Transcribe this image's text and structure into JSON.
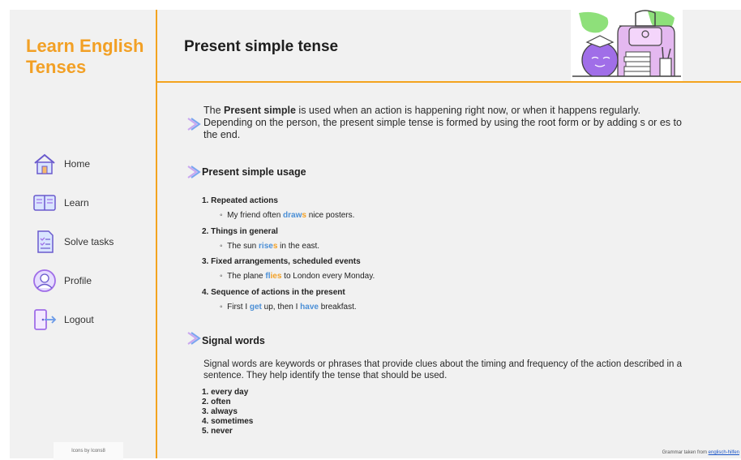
{
  "sidebar": {
    "brand_line1": "Learn English",
    "brand_line2": "Tenses",
    "items": [
      {
        "label": "Home",
        "icon": "home-icon"
      },
      {
        "label": "Learn",
        "icon": "book-icon"
      },
      {
        "label": "Solve tasks",
        "icon": "checklist-icon"
      },
      {
        "label": "Profile",
        "icon": "user-icon"
      },
      {
        "label": "Logout",
        "icon": "logout-icon"
      }
    ],
    "credit": "Icons by Icons8"
  },
  "header": {
    "title": "Present simple tense"
  },
  "intro": {
    "part1": "The ",
    "bold": "Present simple",
    "part2": " is used when an action is happening right now, or when it happens regularly. Depending on the person, the present simple tense is formed by using the root form or by adding s or es to the end."
  },
  "usage": {
    "heading": "Present simple usage",
    "items": [
      {
        "title": "1. Repeated actions",
        "ex_pre": "My friend often ",
        "ex_a": "draw",
        "ex_b": "s",
        "ex_post": " nice posters."
      },
      {
        "title": "2. Things in general",
        "ex_pre": "The sun ",
        "ex_a": "rise",
        "ex_b": "s",
        "ex_post": " in the east."
      },
      {
        "title": "3. Fixed arrangements, scheduled events",
        "ex_pre": "The plane ",
        "ex_a": "fl",
        "ex_b": "ies",
        "ex_post": " to London every Monday."
      },
      {
        "title": "4. Sequence of actions in the present",
        "ex_pre": "First I ",
        "ex_a": "get",
        "ex_mid": " up, then I ",
        "ex_c": "have",
        "ex_post": " breakfast."
      }
    ]
  },
  "signal": {
    "heading": "Signal words",
    "description": "Signal words are keywords or phrases that provide clues about the timing and frequency of the action described in a sentence. They help identify the tense that should be used.",
    "words": [
      "1. every day",
      "2. often",
      "3. always",
      "4. sometimes",
      "5. never"
    ]
  },
  "footer": {
    "text": "Grammar taken from ",
    "link": "englisch-hilfen"
  },
  "colors": {
    "accent": "#f2a025",
    "verb_highlight": "#4b8fd6",
    "icon_purple": "#a06ee8"
  }
}
